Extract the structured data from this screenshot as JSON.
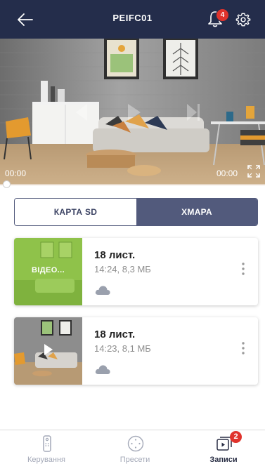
{
  "header": {
    "title": "PEIFC01",
    "notification_count": "4"
  },
  "player": {
    "time_current": "00:00",
    "time_total": "00:00"
  },
  "segments": {
    "sd_label": "КАРТА SD",
    "cloud_label": "ХМАРА",
    "selected": "ХМАРА"
  },
  "recordings": [
    {
      "thumb_label": "ВІДЕО...",
      "date": "18 лист.",
      "meta": "14:24, 8,3 МБ"
    },
    {
      "thumb_label": "",
      "date": "18 лист.",
      "meta": "14:23, 8,1 МБ"
    }
  ],
  "bottom_nav": {
    "items": [
      {
        "label": "Керування",
        "icon": "remote-icon"
      },
      {
        "label": "Пресети",
        "icon": "presets-icon"
      },
      {
        "label": "Записи",
        "icon": "recordings-icon"
      }
    ],
    "active": "Записи",
    "recordings_badge": "2"
  },
  "colors": {
    "header_bg": "#242d4b",
    "segment_active": "#525a7c",
    "badge": "#e0332c",
    "thumb_green": "#8fc24a"
  }
}
